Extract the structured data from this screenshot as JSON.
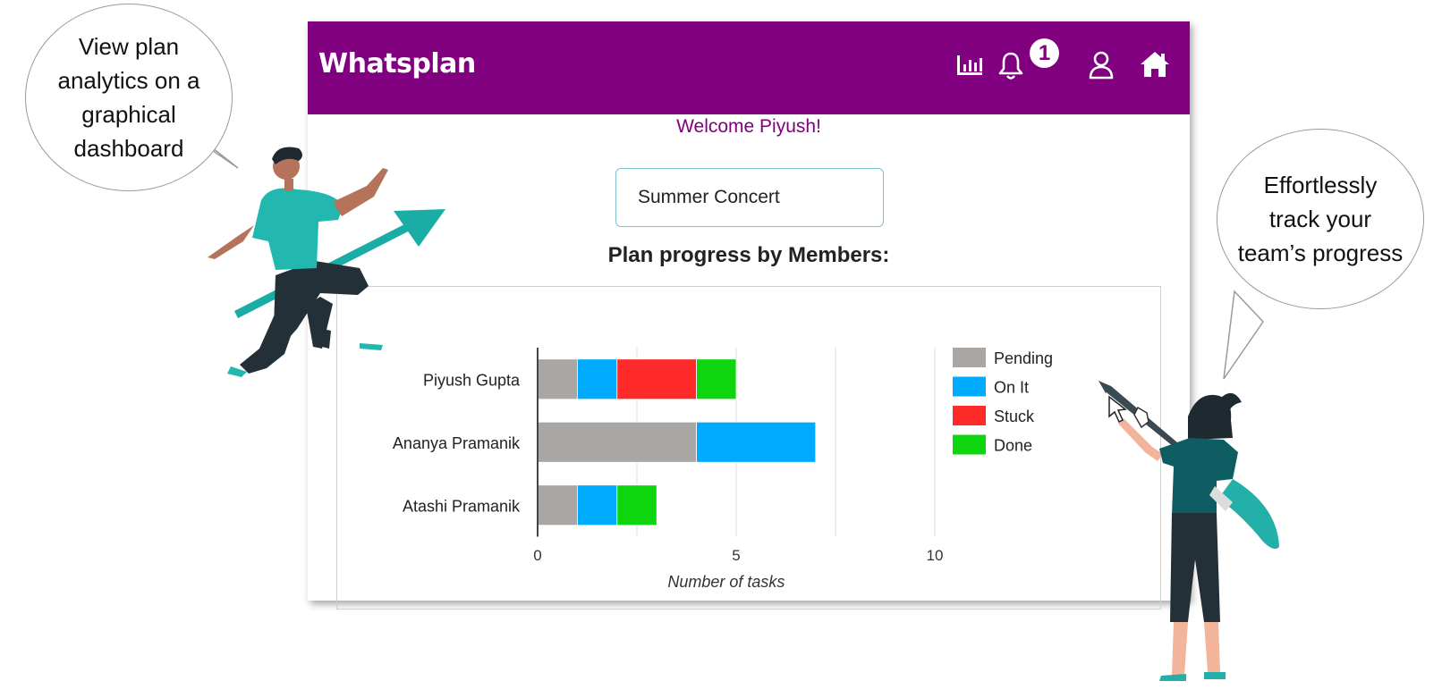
{
  "callouts": {
    "left": [
      "View plan",
      "analytics on a",
      "graphical",
      "dashboard"
    ],
    "right": [
      "Effortlessly",
      "track your",
      "team’s progress"
    ]
  },
  "app": {
    "brand": "Whatsplan",
    "header_color": "#800080",
    "icons": [
      "analytics-icon",
      "bell-icon",
      "user-icon",
      "home-icon"
    ],
    "notification_count": "1",
    "welcome": "Welcome Piyush!",
    "plan_name": "Summer Concert",
    "section_title": "Plan progress by Members:"
  },
  "chart_data": {
    "type": "bar",
    "orientation": "horizontal",
    "stacked": true,
    "categories": [
      "Piyush Gupta",
      "Ananya Pramanik",
      "Atashi Pramanik"
    ],
    "series": [
      {
        "name": "Pending",
        "color": "#aaa6a4",
        "values": [
          1,
          4,
          1
        ]
      },
      {
        "name": "On It",
        "color": "#00aaff",
        "values": [
          1,
          3,
          1
        ]
      },
      {
        "name": "Stuck",
        "color": "#ff2a2a",
        "values": [
          2,
          0,
          0
        ]
      },
      {
        "name": "Done",
        "color": "#0ed60e",
        "values": [
          1,
          0,
          1
        ]
      }
    ],
    "xlabel": "Number of tasks",
    "xlim": [
      0,
      10
    ],
    "xticks": [
      "0",
      "5",
      "10"
    ],
    "grid": true,
    "legend": "right"
  }
}
